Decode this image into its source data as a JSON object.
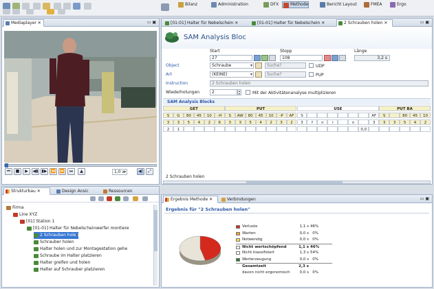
{
  "perspectives": [
    {
      "label": "Bilanz",
      "color": "#c8a040"
    },
    {
      "label": "Administration",
      "color": "#6c8ab0"
    },
    {
      "label": "DFX",
      "color": "#7a9a5a"
    },
    {
      "label": "Methode",
      "color": "#c24a2a"
    },
    {
      "label": "Bericht Layout",
      "color": "#5a7aa8"
    },
    {
      "label": "FMEA",
      "color": "#b06a3a"
    },
    {
      "label": "Ergo",
      "color": "#8a6ab0"
    }
  ],
  "mediaplayer": {
    "tab": "Mediaplayer",
    "speed": "1,0 x",
    "video_colors": {
      "floor": "#d7ccb8",
      "wall": "#9aa7a8",
      "shirt": "#4a1f24",
      "jeans": "#2c3550",
      "bin": "#3a4a3e",
      "machine": "#6d7a72"
    }
  },
  "editor_tabs": [
    {
      "label": "[01-01] Halter für Nebelschein",
      "active": false
    },
    {
      "label": "[01-01] Halter für Nebelschein",
      "active": false
    },
    {
      "label": "2 Schrauben holen",
      "active": true
    }
  ],
  "sam": {
    "title": "SAM Analysis Bloc",
    "start_label": "Start",
    "stopp_label": "Stopp",
    "laenge_label": "Länge",
    "start_value": "27",
    "stopp_value": "108",
    "laenge_value": "3,2 s",
    "object_label": "Object",
    "object_value": "Schraube",
    "object_search": "Suche?",
    "udp_label": "UDP",
    "art_label": "Art",
    "art_value": "(KEINE)",
    "art_search": "Suche?",
    "pup_label": "PUP",
    "instruction_label": "Instruction",
    "instruction_value": "2 Schrauben holen",
    "wdh_label": "Wiederholungen",
    "wdh_value": "2",
    "multiply_label": "Mit der Aktivitätenanalyse multiplizieren",
    "blocks_title": "SAM Analysis Blocks",
    "groups": [
      "GET",
      "PUT",
      "USE",
      "PUT BA"
    ],
    "row1": [
      "S",
      "G",
      "80",
      "45",
      "10",
      "-H",
      "S",
      "AW",
      "80",
      "45",
      "10",
      "-P",
      "AF",
      "S",
      "",
      "",
      "",
      "",
      "",
      "",
      "AF",
      "S",
      "",
      "80",
      "45",
      "10"
    ],
    "row2": [
      "3",
      "3",
      "5",
      "4",
      "2",
      "6",
      "3",
      "3",
      "5",
      "4",
      "2",
      "3",
      "2",
      "3",
      "f",
      "n",
      "i",
      "",
      "n",
      "",
      "3",
      "3",
      "3",
      "5",
      "4",
      "2"
    ],
    "row3": [
      "2",
      "1",
      "",
      "",
      "",
      "",
      "",
      "",
      "",
      "",
      "",
      "",
      "",
      "",
      "",
      "",
      "",
      "",
      "",
      "0,0 s",
      "",
      "",
      "",
      "",
      "",
      ""
    ],
    "footer_text": "2 Schrauben holen"
  },
  "left_tabs": [
    {
      "label": "Strukturbau",
      "active": true
    },
    {
      "label": "Design Ansic",
      "active": false
    },
    {
      "label": "Ressourcen",
      "active": false
    }
  ],
  "tree": [
    {
      "label": "Firma",
      "indent": 0,
      "selected": false,
      "color": "#b07a3a"
    },
    {
      "label": "Line XYZ",
      "indent": 1,
      "selected": false,
      "color": "#c03a2a"
    },
    {
      "label": "[01] Station 1",
      "indent": 2,
      "selected": false,
      "color": "#c03a2a"
    },
    {
      "label": "[01-01] Halter für Nebelscheinwerfer montiere",
      "indent": 3,
      "selected": false,
      "color": "#4a8a3a"
    },
    {
      "label": "2 Schrauben holen",
      "indent": 4,
      "selected": true,
      "color": "#4a8a3a"
    },
    {
      "label": "Schrauber holen",
      "indent": 4,
      "selected": false,
      "color": "#4a8a3a"
    },
    {
      "label": "Halter holen und zur Montagestation gehe",
      "indent": 4,
      "selected": false,
      "color": "#4a8a3a"
    },
    {
      "label": "Schraube im Halter platzieren",
      "indent": 4,
      "selected": false,
      "color": "#4a8a3a"
    },
    {
      "label": "Halter greifen und holen",
      "indent": 4,
      "selected": false,
      "color": "#4a8a3a"
    },
    {
      "label": "Halter auf Schrauber platzieren",
      "indent": 4,
      "selected": false,
      "color": "#4a8a3a"
    }
  ],
  "result": {
    "tab1": "Ergebnis Methode",
    "tab2": "Verbindungen",
    "title": "Ergebnis für \"2 Schrauben holen\"",
    "pie_slices": [
      {
        "name": "Verluste",
        "fraction": 0.46,
        "color": "#d42a1e"
      },
      {
        "name": "Werterzeugung",
        "fraction": 0.54,
        "color": "#e8e4d8"
      }
    ],
    "rows": [
      {
        "name": "Verluste",
        "v1": "1,1 s",
        "v2": "46%",
        "v3": "",
        "color": "#d42a1e",
        "bold": false
      },
      {
        "name": "Warten",
        "v1": "0,0 s",
        "v2": "0%",
        "v3": "",
        "color": "#f0a030",
        "bold": false
      },
      {
        "name": "Notwendig",
        "v1": "0,0 s",
        "v2": "0%",
        "v3": "",
        "color": "#f5e050",
        "bold": false
      },
      {
        "name": "Nicht wertschöpfend",
        "v1": "1,1 s",
        "v2": "46%",
        "v3": "",
        "color": "#ffffff",
        "bold": true
      },
      {
        "name": "Nicht klassifiziert",
        "v1": "1,3 s",
        "v2": "54%",
        "v3": "",
        "color": "#ffffff",
        "bold": false
      },
      {
        "name": "Werterzeugung",
        "v1": "0,0 s",
        "v2": "0%",
        "v3": "",
        "color": "#2e7a2e",
        "bold": false
      },
      {
        "name": "Gesamtzeit",
        "v1": "2,3 s",
        "v2": "",
        "v3": "",
        "color": "",
        "bold": true
      },
      {
        "name": "davon nicht ergonomisch",
        "v1": "0,0 s",
        "v2": "0%",
        "v3": "",
        "color": "",
        "bold": false
      }
    ]
  }
}
